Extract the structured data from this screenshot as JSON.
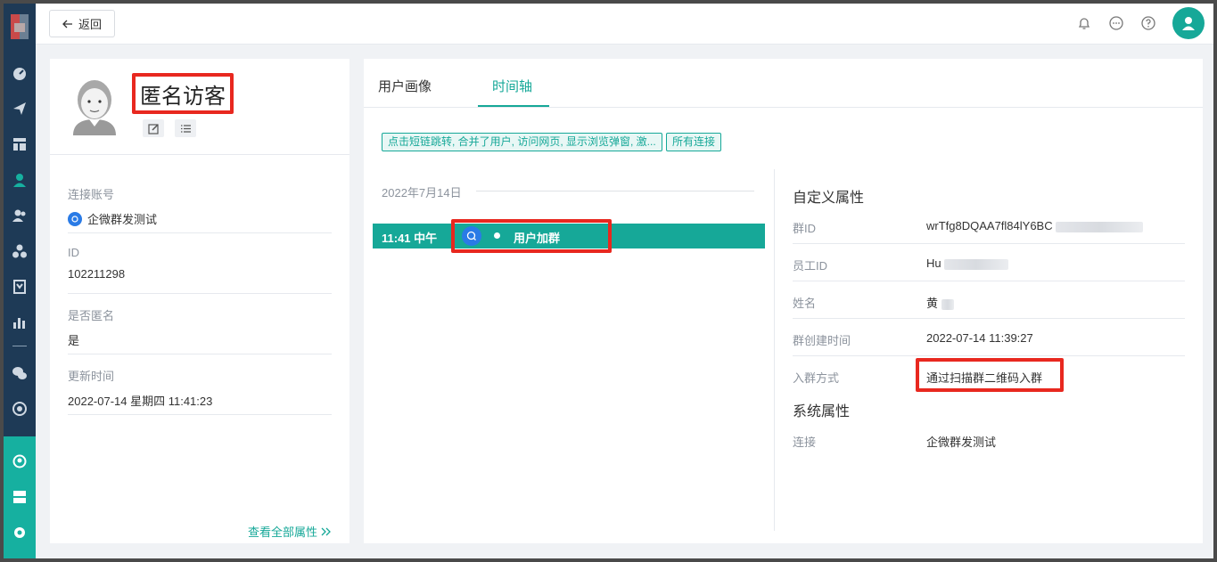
{
  "topbar": {
    "back_label": "返回"
  },
  "profile": {
    "name": "匿名访客",
    "fields": [
      {
        "label": "连接账号",
        "value": "企微群发测试",
        "has_icon": true
      },
      {
        "label": "ID",
        "value": "102211298"
      },
      {
        "label": "是否匿名",
        "value": "是"
      },
      {
        "label": "更新时间",
        "value": "2022-07-14 星期四 11:41:23"
      }
    ],
    "view_all": "查看全部属性"
  },
  "tabs": [
    {
      "label": "用户画像",
      "active": false
    },
    {
      "label": "时间轴",
      "active": true
    }
  ],
  "filters": {
    "events": "点击短链跳转, 合并了用户, 访问网页, 显示浏览弹窗, 激...",
    "connections": "所有连接"
  },
  "timeline": {
    "date": "2022年7月14日",
    "event": {
      "time": "11:41 中午",
      "label": "用户加群"
    }
  },
  "custom_attrs": {
    "title": "自定义属性",
    "rows": [
      {
        "label": "群ID",
        "value": "wrTfg8DQAA7fl84lY6BC"
      },
      {
        "label": "员工ID",
        "value": "Hu"
      },
      {
        "label": "姓名",
        "value": "黄"
      },
      {
        "label": "群创建时间",
        "value": "2022-07-14 11:39:27"
      },
      {
        "label": "入群方式",
        "value": "通过扫描群二维码入群"
      }
    ]
  },
  "system_attrs": {
    "title": "系统属性",
    "rows": [
      {
        "label": "连接",
        "value": "企微群发测试"
      }
    ]
  },
  "colors": {
    "accent": "#16a898",
    "sidebar": "#1e3a56",
    "highlight": "#e8281f",
    "wechat": "#2a7be6"
  }
}
